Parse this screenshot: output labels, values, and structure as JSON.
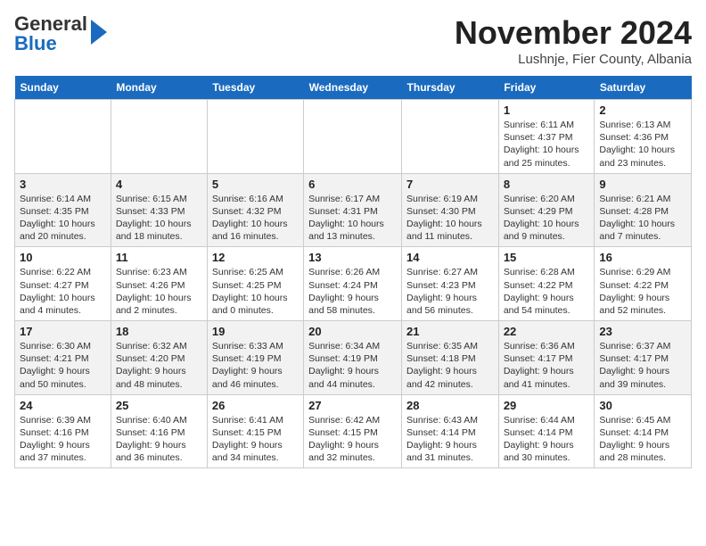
{
  "logo": {
    "general": "General",
    "blue": "Blue"
  },
  "title": "November 2024",
  "subtitle": "Lushnje, Fier County, Albania",
  "weekdays": [
    "Sunday",
    "Monday",
    "Tuesday",
    "Wednesday",
    "Thursday",
    "Friday",
    "Saturday"
  ],
  "weeks": [
    [
      {
        "day": "",
        "info": ""
      },
      {
        "day": "",
        "info": ""
      },
      {
        "day": "",
        "info": ""
      },
      {
        "day": "",
        "info": ""
      },
      {
        "day": "",
        "info": ""
      },
      {
        "day": "1",
        "info": "Sunrise: 6:11 AM\nSunset: 4:37 PM\nDaylight: 10 hours and 25 minutes."
      },
      {
        "day": "2",
        "info": "Sunrise: 6:13 AM\nSunset: 4:36 PM\nDaylight: 10 hours and 23 minutes."
      }
    ],
    [
      {
        "day": "3",
        "info": "Sunrise: 6:14 AM\nSunset: 4:35 PM\nDaylight: 10 hours and 20 minutes."
      },
      {
        "day": "4",
        "info": "Sunrise: 6:15 AM\nSunset: 4:33 PM\nDaylight: 10 hours and 18 minutes."
      },
      {
        "day": "5",
        "info": "Sunrise: 6:16 AM\nSunset: 4:32 PM\nDaylight: 10 hours and 16 minutes."
      },
      {
        "day": "6",
        "info": "Sunrise: 6:17 AM\nSunset: 4:31 PM\nDaylight: 10 hours and 13 minutes."
      },
      {
        "day": "7",
        "info": "Sunrise: 6:19 AM\nSunset: 4:30 PM\nDaylight: 10 hours and 11 minutes."
      },
      {
        "day": "8",
        "info": "Sunrise: 6:20 AM\nSunset: 4:29 PM\nDaylight: 10 hours and 9 minutes."
      },
      {
        "day": "9",
        "info": "Sunrise: 6:21 AM\nSunset: 4:28 PM\nDaylight: 10 hours and 7 minutes."
      }
    ],
    [
      {
        "day": "10",
        "info": "Sunrise: 6:22 AM\nSunset: 4:27 PM\nDaylight: 10 hours and 4 minutes."
      },
      {
        "day": "11",
        "info": "Sunrise: 6:23 AM\nSunset: 4:26 PM\nDaylight: 10 hours and 2 minutes."
      },
      {
        "day": "12",
        "info": "Sunrise: 6:25 AM\nSunset: 4:25 PM\nDaylight: 10 hours and 0 minutes."
      },
      {
        "day": "13",
        "info": "Sunrise: 6:26 AM\nSunset: 4:24 PM\nDaylight: 9 hours and 58 minutes."
      },
      {
        "day": "14",
        "info": "Sunrise: 6:27 AM\nSunset: 4:23 PM\nDaylight: 9 hours and 56 minutes."
      },
      {
        "day": "15",
        "info": "Sunrise: 6:28 AM\nSunset: 4:22 PM\nDaylight: 9 hours and 54 minutes."
      },
      {
        "day": "16",
        "info": "Sunrise: 6:29 AM\nSunset: 4:22 PM\nDaylight: 9 hours and 52 minutes."
      }
    ],
    [
      {
        "day": "17",
        "info": "Sunrise: 6:30 AM\nSunset: 4:21 PM\nDaylight: 9 hours and 50 minutes."
      },
      {
        "day": "18",
        "info": "Sunrise: 6:32 AM\nSunset: 4:20 PM\nDaylight: 9 hours and 48 minutes."
      },
      {
        "day": "19",
        "info": "Sunrise: 6:33 AM\nSunset: 4:19 PM\nDaylight: 9 hours and 46 minutes."
      },
      {
        "day": "20",
        "info": "Sunrise: 6:34 AM\nSunset: 4:19 PM\nDaylight: 9 hours and 44 minutes."
      },
      {
        "day": "21",
        "info": "Sunrise: 6:35 AM\nSunset: 4:18 PM\nDaylight: 9 hours and 42 minutes."
      },
      {
        "day": "22",
        "info": "Sunrise: 6:36 AM\nSunset: 4:17 PM\nDaylight: 9 hours and 41 minutes."
      },
      {
        "day": "23",
        "info": "Sunrise: 6:37 AM\nSunset: 4:17 PM\nDaylight: 9 hours and 39 minutes."
      }
    ],
    [
      {
        "day": "24",
        "info": "Sunrise: 6:39 AM\nSunset: 4:16 PM\nDaylight: 9 hours and 37 minutes."
      },
      {
        "day": "25",
        "info": "Sunrise: 6:40 AM\nSunset: 4:16 PM\nDaylight: 9 hours and 36 minutes."
      },
      {
        "day": "26",
        "info": "Sunrise: 6:41 AM\nSunset: 4:15 PM\nDaylight: 9 hours and 34 minutes."
      },
      {
        "day": "27",
        "info": "Sunrise: 6:42 AM\nSunset: 4:15 PM\nDaylight: 9 hours and 32 minutes."
      },
      {
        "day": "28",
        "info": "Sunrise: 6:43 AM\nSunset: 4:14 PM\nDaylight: 9 hours and 31 minutes."
      },
      {
        "day": "29",
        "info": "Sunrise: 6:44 AM\nSunset: 4:14 PM\nDaylight: 9 hours and 30 minutes."
      },
      {
        "day": "30",
        "info": "Sunrise: 6:45 AM\nSunset: 4:14 PM\nDaylight: 9 hours and 28 minutes."
      }
    ]
  ]
}
